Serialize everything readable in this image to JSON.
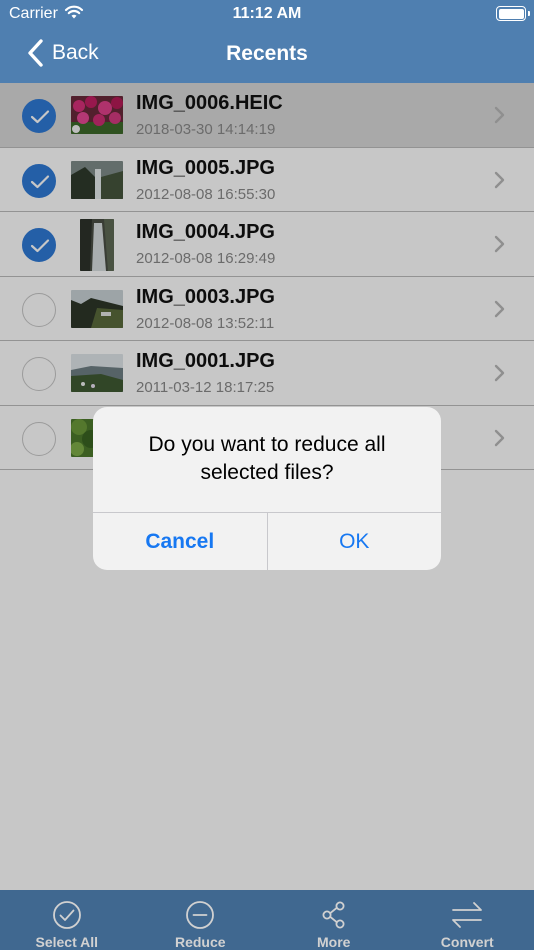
{
  "status": {
    "carrier": "Carrier",
    "time": "11:12 AM"
  },
  "nav": {
    "back_label": "Back",
    "title": "Recents"
  },
  "files": [
    {
      "name": "IMG_0006.HEIC",
      "date": "2018-03-30 14:14:19",
      "selected": true,
      "thumb": "flowers"
    },
    {
      "name": "IMG_0005.JPG",
      "date": "2012-08-08 16:55:30",
      "selected": true,
      "thumb": "waterfall-wide"
    },
    {
      "name": "IMG_0004.JPG",
      "date": "2012-08-08 16:29:49",
      "selected": true,
      "thumb": "waterfall-portrait"
    },
    {
      "name": "IMG_0003.JPG",
      "date": "2012-08-08 13:52:11",
      "selected": false,
      "thumb": "landscape"
    },
    {
      "name": "IMG_0001.JPG",
      "date": "2011-03-12 18:17:25",
      "selected": false,
      "thumb": "coast"
    },
    {
      "name": "",
      "date": "",
      "selected": false,
      "thumb": "trees"
    }
  ],
  "alert": {
    "message": "Do you want to reduce all selected files?",
    "cancel_label": "Cancel",
    "ok_label": "OK"
  },
  "toolbar": {
    "select_all": "Select All",
    "reduce": "Reduce",
    "more": "More",
    "convert": "Convert"
  },
  "colors": {
    "bar": "#4f7fb0",
    "check": "#2f7ad6",
    "alert_button": "#1778f2"
  }
}
